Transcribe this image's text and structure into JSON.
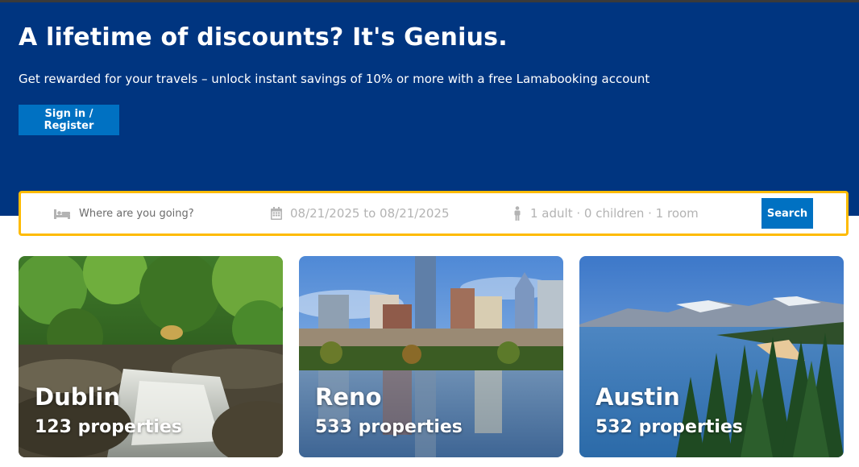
{
  "hero": {
    "title": "A lifetime of discounts? It's Genius.",
    "subtitle": "Get rewarded for your travels – unlock instant savings of 10% or more with a free Lamabooking account",
    "signin_label": "Sign in / Register",
    "background_color": "#003580",
    "button_color": "#0071c2"
  },
  "search": {
    "destination_placeholder": "Where are you going?",
    "destination_icon": "bed-icon",
    "dates": "08/21/2025 to 08/21/2025",
    "dates_icon": "calendar-icon",
    "guests": "1 adult · 0 children · 1 room",
    "guests_icon": "person-icon",
    "search_label": "Search",
    "border_color": "#febb02"
  },
  "destinations": [
    {
      "name": "Dublin",
      "properties": "123 properties",
      "image": "forest waterfall"
    },
    {
      "name": "Reno",
      "properties": "533 properties",
      "image": "city skyline reflected in lake"
    },
    {
      "name": "Austin",
      "properties": "532 properties",
      "image": "lake with mountains and pine trees"
    }
  ]
}
